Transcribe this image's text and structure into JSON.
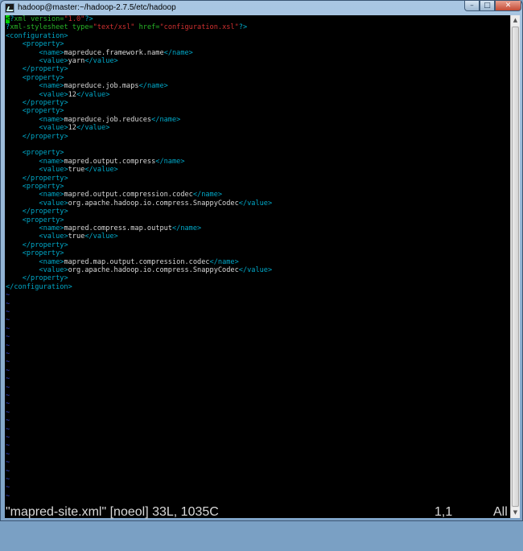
{
  "window": {
    "title": "hadoop@master:~/hadoop-2.7.5/etc/hadoop",
    "minimize_glyph": "–",
    "maximize_glyph": "□",
    "close_glyph": "✕"
  },
  "editor": {
    "cursor_char": "<",
    "line1": {
      "tail": "?",
      "attr1": "xml version=",
      "val1": "\"1.0\""
    },
    "line2": {
      "pi": "?",
      "attr1": "xml-stylesheet type=",
      "val1": "\"text/xsl\"",
      "attr2": " href=",
      "val2": "\"configuration.xsl\"",
      "end": "?>"
    },
    "cfg_open": "<configuration>",
    "cfg_close": "</configuration>",
    "prop_open": "<property>",
    "prop_close": "</property>",
    "name_open": "<name>",
    "name_close": "</name>",
    "value_open": "<value>",
    "value_close": "</value>",
    "indent_prop": "    ",
    "indent_child": "        ",
    "properties": [
      {
        "name": "mapreduce.framework.name",
        "value": "yarn"
      },
      {
        "name": "mapreduce.job.maps",
        "value": "12"
      },
      {
        "name": "mapreduce.job.reduces",
        "value": "12"
      },
      {
        "name": "mapred.output.compress",
        "value": "true"
      },
      {
        "name": "mapred.output.compression.codec",
        "value": "org.apache.hadoop.io.compress.SnappyCodec"
      },
      {
        "name": "mapred.compress.map.output",
        "value": "true"
      },
      {
        "name": "mapred.map.output.compression.codec",
        "value": "org.apache.hadoop.io.compress.SnappyCodec"
      }
    ],
    "tilde_char": "~",
    "tilde_count": 25
  },
  "status": {
    "file": "\"mapred-site.xml\" [noeol] 33L, 1035C",
    "position": "1,1",
    "percent": "All"
  },
  "scrollbar": {
    "up_glyph": "▲",
    "down_glyph": "▼"
  },
  "colors": {
    "tag": "#00a8c8",
    "attribute": "#28b428",
    "string": "#d03030",
    "text": "#d8d8d8",
    "tilde": "#3548d8",
    "cursor": "#00cd00",
    "background": "#000000"
  }
}
